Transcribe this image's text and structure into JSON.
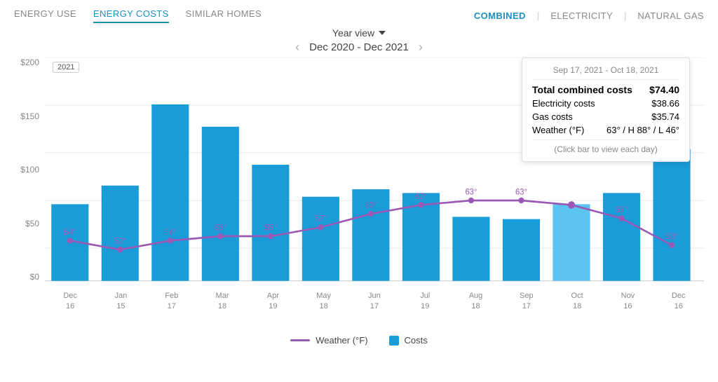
{
  "tabs": [
    {
      "label": "ENERGY USE",
      "active": false
    },
    {
      "label": "ENERGY COSTS",
      "active": true
    },
    {
      "label": "SIMILAR HOMES",
      "active": false
    }
  ],
  "filters": [
    {
      "label": "COMBINED",
      "active": true
    },
    {
      "label": "ELECTRICITY",
      "active": false
    },
    {
      "label": "NATURAL GAS",
      "active": false
    }
  ],
  "view_selector": "Year view",
  "date_range_label": "Dec 2020 - Dec 2021",
  "year_marker": "2021",
  "tooltip": {
    "date": "Sep 17, 2021 - Oct 18, 2021",
    "total_label": "Total combined costs",
    "total_value": "$74.40",
    "electricity_label": "Electricity costs",
    "electricity_value": "$38.66",
    "gas_label": "Gas costs",
    "gas_value": "$35.74",
    "weather_label": "Weather (°F)",
    "weather_value": "63° / H 88° / L 46°",
    "note": "(Click bar to view each day)"
  },
  "legend": {
    "weather_label": "Weather (°F)",
    "costs_label": "Costs"
  },
  "x_labels": [
    {
      "line1": "Dec",
      "line2": "16"
    },
    {
      "line1": "Jan",
      "line2": "15"
    },
    {
      "line1": "Feb",
      "line2": "17"
    },
    {
      "line1": "Mar",
      "line2": "18"
    },
    {
      "line1": "Apr",
      "line2": "19"
    },
    {
      "line1": "May",
      "line2": "18"
    },
    {
      "line1": "Jun",
      "line2": "17"
    },
    {
      "line1": "Jul",
      "line2": "19"
    },
    {
      "line1": "Aug",
      "line2": "18"
    },
    {
      "line1": "Sep",
      "line2": "17"
    },
    {
      "line1": "Oct",
      "line2": "18"
    },
    {
      "line1": "Nov",
      "line2": "16"
    },
    {
      "line1": "Dec",
      "line2": "16"
    }
  ],
  "y_labels": [
    "$200",
    "$150",
    "$100",
    "$50",
    "$0"
  ],
  "bars": [
    80,
    100,
    185,
    162,
    122,
    88,
    96,
    92,
    67,
    65,
    80,
    92,
    138
  ],
  "weather_temps": [
    54,
    52,
    54,
    55,
    55,
    57,
    60,
    62,
    63,
    63,
    62,
    59,
    53
  ],
  "temp_labels": [
    "54°",
    "52°",
    "54°",
    "55°",
    "55°",
    "57°",
    "60°",
    "62°",
    "63°",
    "63°",
    "",
    "59°",
    "53°"
  ],
  "colors": {
    "tab_active": "#1a8fc1",
    "bar": "#1a9cd8",
    "bar_highlighted": "#5bc4f0",
    "weather_line": "#9b59b6",
    "grid_line": "#e8e8e8",
    "text": "#444"
  }
}
